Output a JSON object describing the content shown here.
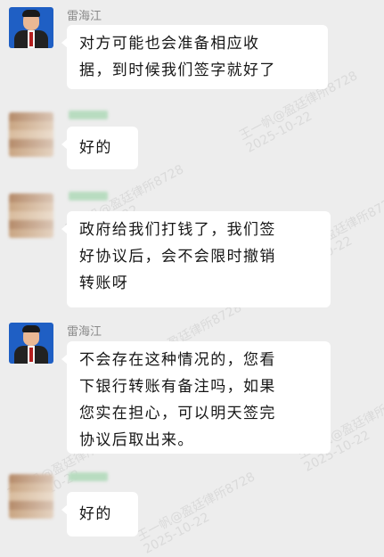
{
  "messages": [
    {
      "sender": "雷海江",
      "avatar": "lawyer-avatar",
      "text": "对方可能也会准备相应收\n据，到时候我们签字就好了"
    },
    {
      "sender": "",
      "avatar": "blurred-avatar",
      "text": "好的"
    },
    {
      "sender": "",
      "avatar": "blurred-avatar",
      "text": "政府给我们打钱了，我们签\n好协议后，会不会限时撤销\n转账呀"
    },
    {
      "sender": "雷海江",
      "avatar": "lawyer-avatar",
      "text": "不会存在这种情况的，您看\n下银行转账有备注吗，如果\n您实在担心，可以明天签完\n协议后取出来。"
    },
    {
      "sender": "",
      "avatar": "blurred-avatar",
      "text": "好的"
    }
  ],
  "watermark": {
    "line1": "王一帆@盈廷律所8728",
    "line2": "2025-10-22"
  },
  "colors": {
    "background": "#ededed",
    "bubble": "#ffffff",
    "sender_text": "#8a8a8a"
  }
}
